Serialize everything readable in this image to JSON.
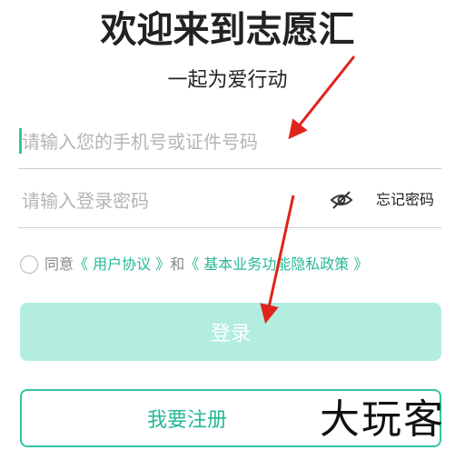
{
  "header": {
    "title": "欢迎来到志愿汇",
    "subtitle": "一起为爱行动"
  },
  "login_form": {
    "phone_placeholder": "请输入您的手机号或证件号码",
    "phone_value": "",
    "password_placeholder": "请输入登录密码",
    "password_value": "",
    "forgot_password": "忘记密码",
    "password_visibility_icon": "eye-off-icon"
  },
  "agreement": {
    "checked": false,
    "prefix": "同意",
    "user_agreement": "《 用户协议 》",
    "conjunction": "和",
    "privacy_policy": "《 基本业务功能隐私政策 》"
  },
  "buttons": {
    "login": "登录",
    "register": "我要注册"
  },
  "watermark": "大玩客",
  "colors": {
    "accent": "#35c3a3",
    "link": "#27b896",
    "login_disabled_bg": "#b3ede0",
    "annotation_arrow": "#e0241b"
  }
}
